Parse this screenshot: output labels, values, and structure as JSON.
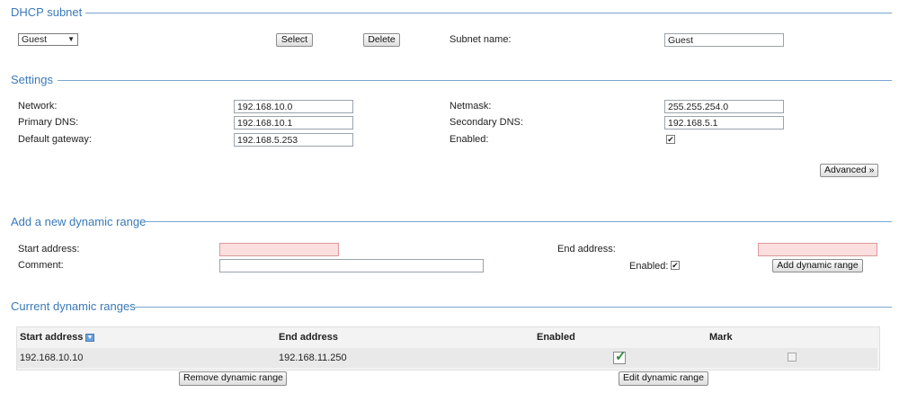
{
  "dhcp_subnet": {
    "title": "DHCP subnet",
    "selected_subnet": "Guest",
    "select_label": "Select",
    "delete_label": "Delete",
    "subnet_name_label": "Subnet name:",
    "subnet_name_value": "Guest"
  },
  "settings": {
    "title": "Settings",
    "network_label": "Network:",
    "network_value": "192.168.10.0",
    "netmask_label": "Netmask:",
    "netmask_value": "255.255.254.0",
    "primary_dns_label": "Primary DNS:",
    "primary_dns_value": "192.168.10.1",
    "secondary_dns_label": "Secondary DNS:",
    "secondary_dns_value": "192.168.5.1",
    "default_gateway_label": "Default gateway:",
    "default_gateway_value": "192.168.5.253",
    "enabled_label": "Enabled:",
    "enabled_mark": "✔",
    "advanced_label": "Advanced »"
  },
  "add_range": {
    "title": "Add a new dynamic range",
    "start_label": "Start address:",
    "start_value": "",
    "end_label": "End address:",
    "end_value": "",
    "comment_label": "Comment:",
    "comment_value": "",
    "enabled_label": "Enabled:",
    "enabled_mark": "✔",
    "add_button_label": "Add dynamic range"
  },
  "current_ranges": {
    "title": "Current dynamic ranges",
    "columns": [
      "Start address",
      "End address",
      "Enabled",
      "Mark"
    ],
    "sort_icon_glyph": "▼",
    "rows": [
      {
        "start": "192.168.10.10",
        "end": "192.168.11.250",
        "enabled_mark": "✓"
      }
    ],
    "remove_button_label": "Remove dynamic range",
    "edit_button_label": "Edit dynamic range"
  },
  "colors": {
    "section_title": "#3a7ab8",
    "required_field_bg": "#fbdfdf",
    "enabled_check": "#2e8b3a"
  },
  "icons": {
    "dropdown": "chevron-down-icon",
    "sort": "sort-descending-icon",
    "enabled": "check-icon"
  }
}
